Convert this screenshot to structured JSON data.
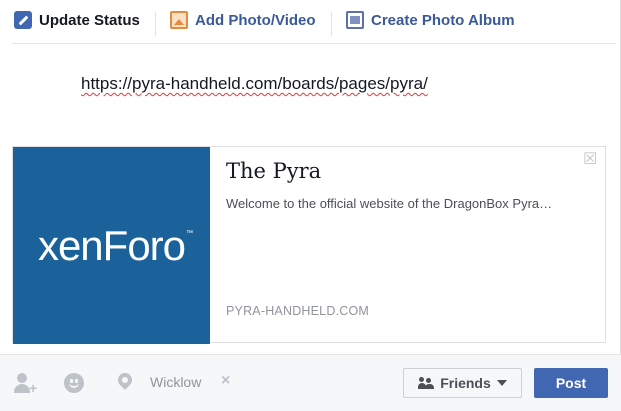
{
  "tabs": [
    {
      "label": "Update Status",
      "icon": "pencil-icon"
    },
    {
      "label": "Add Photo/Video",
      "icon": "photo-icon"
    },
    {
      "label": "Create Photo Album",
      "icon": "album-icon"
    }
  ],
  "composer": {
    "status_text": "https://pyra-handheld.com/boards/pages/pyra/"
  },
  "link_preview": {
    "logo_text": "xenForo",
    "logo_tm": "™",
    "title": "The Pyra",
    "description": "Welcome to the official website of the DragonBox Pyra…",
    "domain": "PYRA-HANDHELD.COM",
    "close_glyph": "☒"
  },
  "bottom_bar": {
    "location": "Wicklow",
    "remove_location": "×",
    "audience_label": "Friends",
    "post_label": "Post"
  },
  "colors": {
    "brand_blue": "#4267b2",
    "link_blue": "#3b5998",
    "thumb_bg": "#1b629a"
  }
}
